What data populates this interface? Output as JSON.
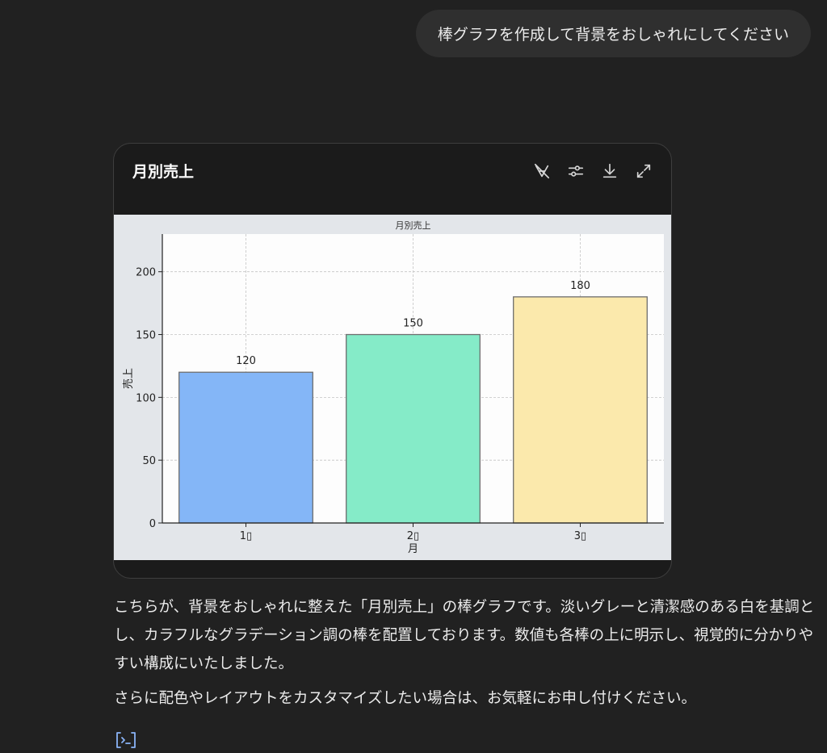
{
  "user_message": "棒グラフを作成して背景をおしゃれにしてください",
  "card": {
    "title": "月別売上",
    "tools": [
      "chart-mode-icon",
      "sliders-icon",
      "download-icon",
      "expand-icon"
    ]
  },
  "chart_data": {
    "type": "bar",
    "title": "月別売上",
    "xlabel": "月",
    "ylabel": "売上",
    "categories": [
      "1月",
      "2月",
      "3月"
    ],
    "category_labels_rendered": [
      "1▯",
      "2▯",
      "3▯"
    ],
    "values": [
      120,
      150,
      180
    ],
    "data_labels": [
      "120",
      "150",
      "180"
    ],
    "colors": [
      "#84b6f7",
      "#85ebc8",
      "#fbe9ac"
    ],
    "ylim": [
      0,
      230
    ],
    "yticks": [
      0,
      50,
      100,
      150,
      200
    ],
    "grid": true,
    "figure_background": "#e3e6ea",
    "axes_background": "#fdfdfd"
  },
  "response": {
    "paragraphs": [
      "こちらが、背景をおしゃれに整えた「月別売上」の棒グラフです。淡いグレーと清潔感のある白を基調とし、カラフルなグラデーション調の棒を配置しております。数値も各棒の上に明示し、視覚的に分かりやすい構成にいたしました。",
      "さらに配色やレイアウトをカスタマイズしたい場合は、お気軽にお申し付けください。"
    ]
  },
  "code_icon": "code-icon"
}
